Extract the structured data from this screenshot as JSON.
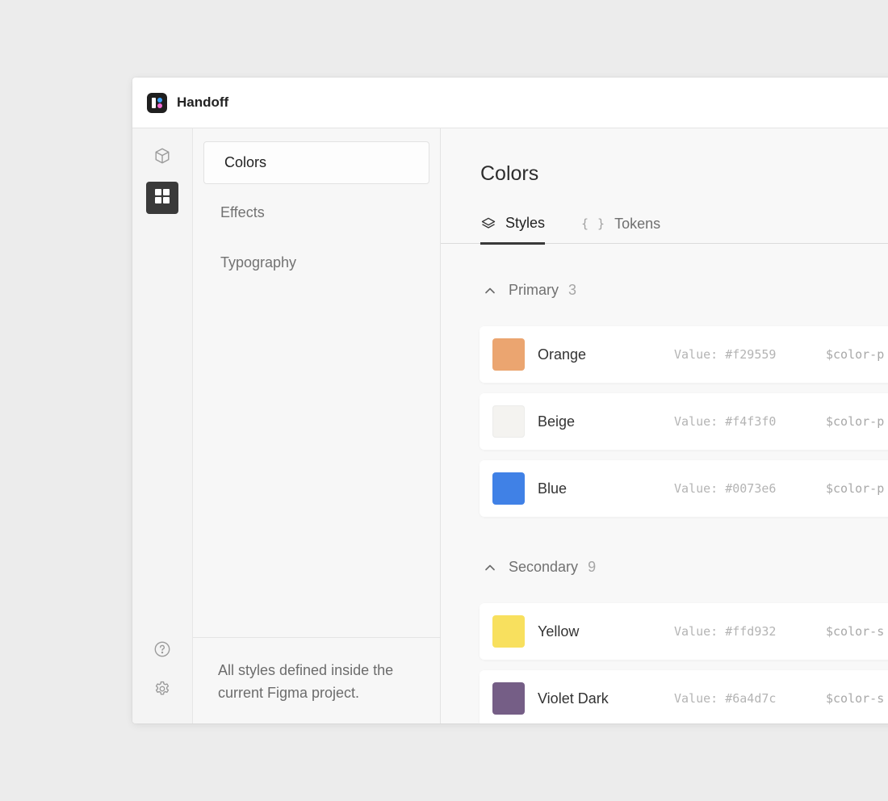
{
  "app": {
    "name": "Handoff"
  },
  "rail": {
    "items": [
      {
        "icon": "cube-icon",
        "active": false
      },
      {
        "icon": "grid-icon",
        "active": true
      }
    ],
    "bottom": [
      {
        "icon": "help-icon"
      },
      {
        "icon": "gear-icon"
      }
    ]
  },
  "subnav": {
    "items": [
      {
        "label": "Colors",
        "active": true
      },
      {
        "label": "Effects",
        "active": false
      },
      {
        "label": "Typography",
        "active": false
      }
    ],
    "footer": "All styles defined inside the current Figma project."
  },
  "main": {
    "title": "Colors",
    "tabs": [
      {
        "label": "Styles",
        "icon": "layers-icon",
        "active": true
      },
      {
        "label": "Tokens",
        "icon": "braces-icon",
        "icon_text": "{ }",
        "active": false
      }
    ],
    "groups": [
      {
        "name": "Primary",
        "count": "3",
        "colors": [
          {
            "name": "Orange",
            "value": "Value: #f29559",
            "token": "$color-p",
            "swatch": "#eba570"
          },
          {
            "name": "Beige",
            "value": "Value: #f4f3f0",
            "token": "$color-p",
            "swatch": "#f4f3f0"
          },
          {
            "name": "Blue",
            "value": "Value: #0073e6",
            "token": "$color-p",
            "swatch": "#4081e6"
          }
        ]
      },
      {
        "name": "Secondary",
        "count": "9",
        "colors": [
          {
            "name": "Yellow",
            "value": "Value: #ffd932",
            "token": "$color-s",
            "swatch": "#f8e05e"
          },
          {
            "name": "Violet Dark",
            "value": "Value: #6a4d7c",
            "token": "$color-s",
            "swatch": "#755e86"
          }
        ]
      }
    ]
  }
}
